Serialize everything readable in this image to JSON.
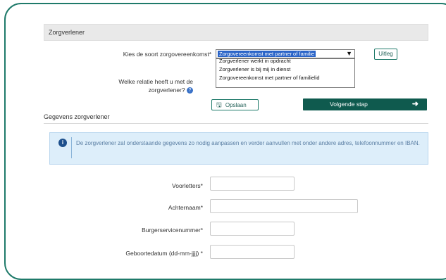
{
  "section": {
    "title": "Zorgverlener"
  },
  "form": {
    "contract_label": "Kies de soort zorgovereenkomst*",
    "contract_selected": "Zorgovereenkomst met partner of familie",
    "contract_options": [
      "Zorgverlener werkt in opdracht",
      "Zorgverlener is bij mij in dienst",
      "Zorgovereenkomst met partner of familielid"
    ],
    "relation_label_line1": "Welke relatie heeft u met de",
    "relation_label_line2": "zorgverlener?",
    "uitleg_label": "Uitleg",
    "save_label": "Opslaan",
    "next_label": "Volgende stap"
  },
  "details": {
    "heading": "Gegevens zorgverlener",
    "info_text": "De zorgverlener zal onderstaande gegevens zo nodig aanpassen en verder aanvullen met onder andere adres, telefoonnummer en IBAN.",
    "fields": {
      "initials_label": "Voorletters*",
      "lastname_label": "Achternaam*",
      "bsn_label": "Burgerservicenummer*",
      "dob_label": "Geboortedatum (dd-mm-jjjj) *"
    }
  },
  "icons": {
    "help": "question-circle-icon",
    "save": "floppy-disk-icon",
    "next": "arrow-right-icon",
    "info": "info-icon",
    "caret": "chevron-down-icon"
  },
  "colors": {
    "brand": "#0f5a4e",
    "selection": "#2a64c8",
    "info_bg": "#ddeefa",
    "info_icon": "#1d4f8c"
  }
}
